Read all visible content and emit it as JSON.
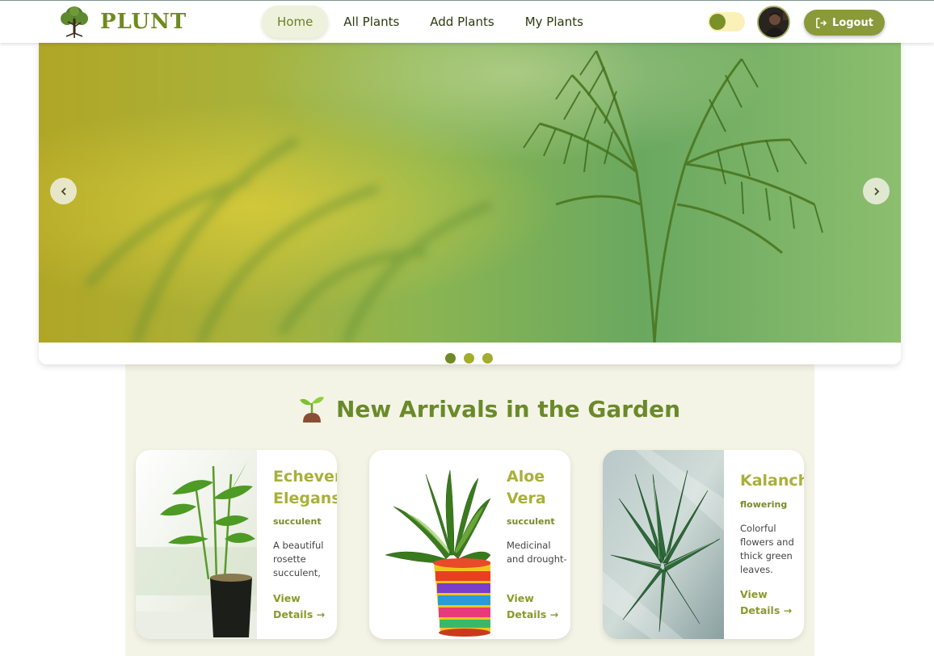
{
  "brand": {
    "name": "PLUNT"
  },
  "nav": {
    "links": [
      {
        "label": "Home",
        "active": true
      },
      {
        "label": "All Plants",
        "active": false
      },
      {
        "label": "Add Plants",
        "active": false
      },
      {
        "label": "My Plants",
        "active": false
      }
    ],
    "logout_label": "Logout"
  },
  "hero": {
    "slide_count": 3,
    "active_slide": 1
  },
  "section": {
    "title": "New Arrivals in the Garden"
  },
  "cards": [
    {
      "name_line1": "Echeveria",
      "name_line2": "Elegans",
      "category": "succulent",
      "desc": "A beautiful rosette succulent,",
      "link_line1": "View",
      "link_line2": "Details →"
    },
    {
      "name_line1": "Aloe",
      "name_line2": "Vera",
      "category": "succulent",
      "desc": "Medicinal and drought-",
      "link_line1": "View",
      "link_line2": "Details →"
    },
    {
      "name_line1": "Kalanchoe",
      "name_line2": "",
      "category": "flowering",
      "desc": "Colorful flowers and thick green leaves.",
      "link_line1": "View",
      "link_line2": "Details →"
    }
  ],
  "colors": {
    "brand_green": "#6f8a1f",
    "section_bg": "#f4f4e6",
    "logout_bg": "#8a9a3a"
  }
}
